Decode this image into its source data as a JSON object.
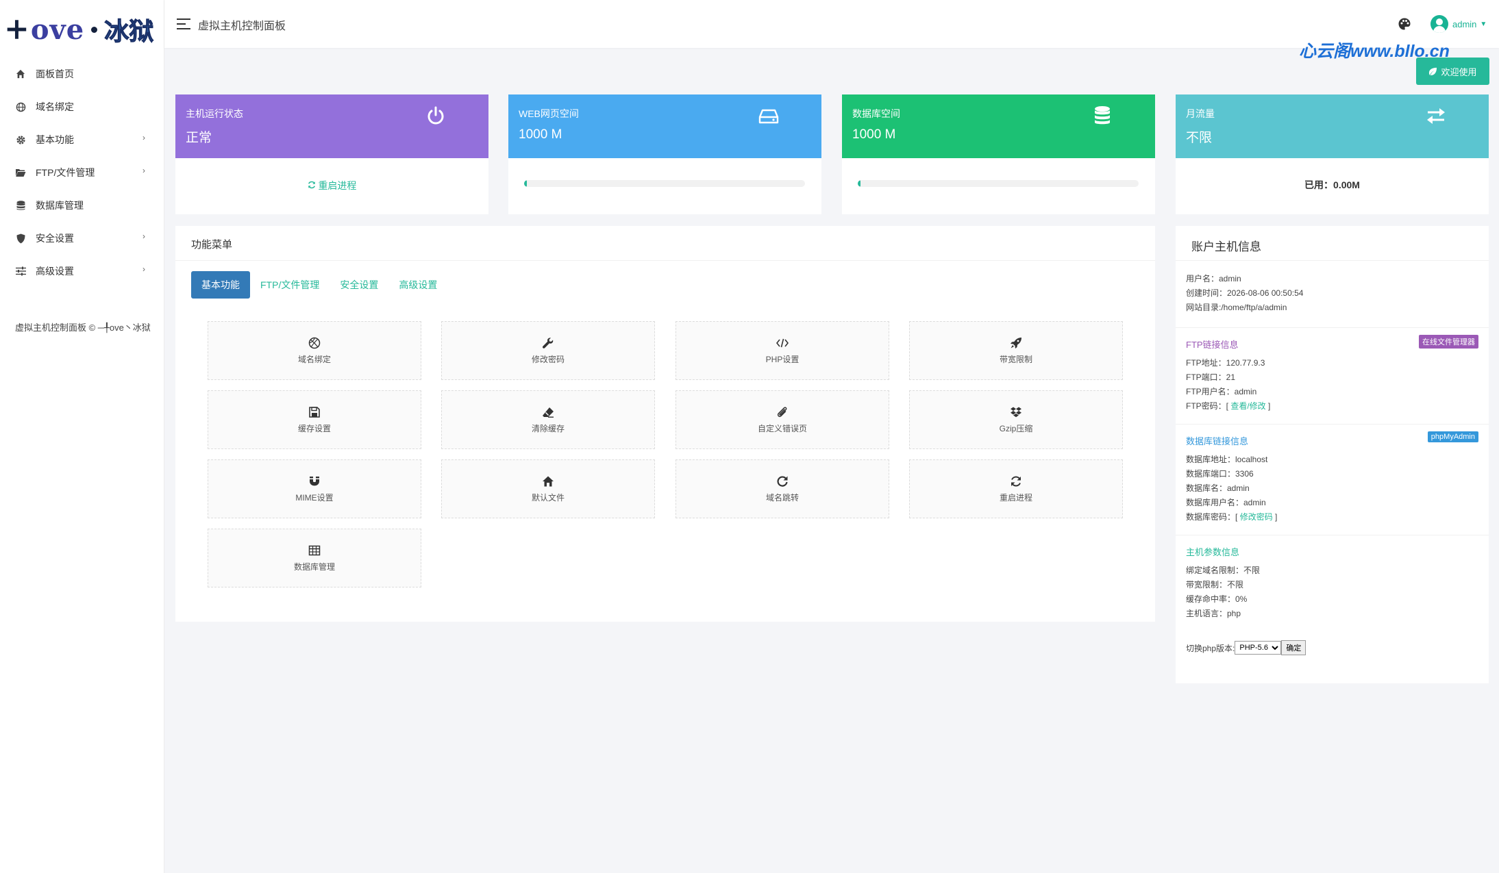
{
  "brand": {
    "logo_mark": "+",
    "logo_text": "ove",
    "logo_cn": "冰狱"
  },
  "header": {
    "title": "虚拟主机控制面板",
    "user": "admin"
  },
  "watermark": "心云阁www.bllo.cn",
  "welcome_button": "欢迎使用",
  "sidebar": {
    "items": [
      {
        "label": "面板首页",
        "icon": "home-icon"
      },
      {
        "label": "域名绑定",
        "icon": "globe-icon"
      },
      {
        "label": "基本功能",
        "icon": "gear-icon",
        "arrow": "›"
      },
      {
        "label": "FTP/文件管理",
        "icon": "folder-icon",
        "arrow": "›"
      },
      {
        "label": "数据库管理",
        "icon": "database-icon"
      },
      {
        "label": "安全设置",
        "icon": "shield-icon",
        "arrow": "›"
      },
      {
        "label": "高级设置",
        "icon": "sliders-icon",
        "arrow": "›"
      }
    ],
    "footer": "虚拟主机控制面板 © ─╀ove丶冰狱"
  },
  "stats": [
    {
      "label": "主机运行状态",
      "value": "正常",
      "color": "#9370db",
      "action": "重启进程"
    },
    {
      "label": "WEB网页空间",
      "value": "1000 M",
      "color": "#4aaaf0",
      "progress": 0.01
    },
    {
      "label": "数据库空间",
      "value": "1000 M",
      "color": "#1cc174",
      "progress": 0.01
    },
    {
      "label": "月流量",
      "value": "不限",
      "color": "#5bc5d0",
      "used": "已用：0.00M"
    }
  ],
  "panel": {
    "title": "功能菜单",
    "tabs": [
      "基本功能",
      "FTP/文件管理",
      "安全设置",
      "高级设置"
    ],
    "tiles": [
      "域名绑定",
      "修改密码",
      "PHP设置",
      "带宽限制",
      "缓存设置",
      "清除缓存",
      "自定义错误页",
      "Gzip压缩",
      "MIME设置",
      "默认文件",
      "域名跳转",
      "重启进程",
      "数据库管理"
    ]
  },
  "info": {
    "title": "账户主机信息",
    "account": [
      "用户名：admin",
      "创建时间：2026-08-06 00:50:54",
      "网站目录:/home/ftp/a/admin"
    ],
    "ftp": {
      "title": "FTP链接信息",
      "badge": "在线文件管理器",
      "badge_color": "#9b59b6",
      "lines": [
        "FTP地址：120.77.9.3",
        "FTP端口：21",
        "FTP用户名：admin"
      ],
      "pw_label": "FTP密码：[",
      "pw_link": "查看/修改",
      "pw_end": "]"
    },
    "db": {
      "title": "数据库链接信息",
      "badge": "phpMyAdmin",
      "badge_color": "#3498db",
      "lines": [
        "数据库地址：localhost",
        "数据库端口：3306",
        "数据库名：admin",
        "数据库用户名：admin"
      ],
      "pw_label": "数据库密码：[",
      "pw_link": "修改密码",
      "pw_end": "]"
    },
    "host": {
      "title": "主机参数信息",
      "lines": [
        "绑定域名限制：不限",
        "带宽限制：不限",
        "缓存命中率：0%",
        "主机语言：php"
      ],
      "php_label": "切换php版本:",
      "php_selected": "PHP-5.6",
      "php_button": "确定"
    }
  }
}
